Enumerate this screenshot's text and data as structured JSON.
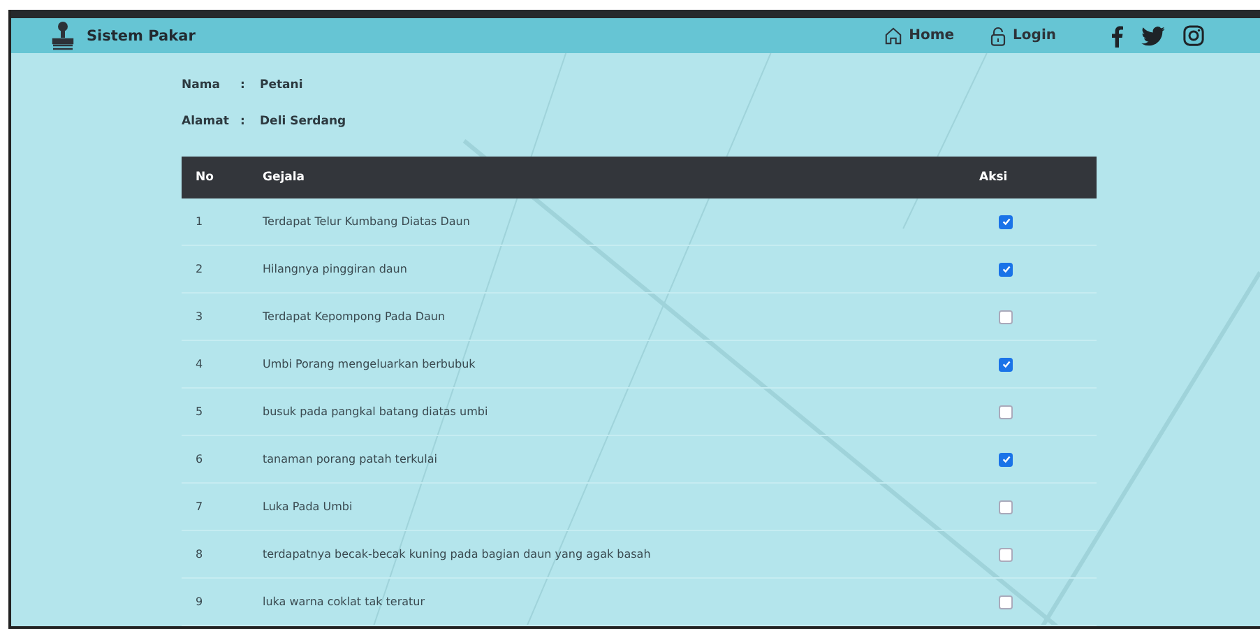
{
  "navbar": {
    "brand": "Sistem Pakar",
    "links": [
      {
        "kind": "home",
        "label": "Home"
      },
      {
        "kind": "login",
        "label": "Login"
      }
    ],
    "social": [
      {
        "kind": "facebook"
      },
      {
        "kind": "twitter"
      },
      {
        "kind": "instagram"
      }
    ]
  },
  "profile": [
    {
      "label": "Nama",
      "separator": ":",
      "value": "Petani"
    },
    {
      "label": "Alamat",
      "separator": ":",
      "value": "Deli Serdang"
    }
  ],
  "table": {
    "columns": [
      "No",
      "Gejala",
      "Aksi"
    ],
    "rows": [
      {
        "no": "1",
        "gejala": "Terdapat Telur Kumbang Diatas Daun",
        "checked": true
      },
      {
        "no": "2",
        "gejala": "Hilangnya pinggiran daun",
        "checked": true
      },
      {
        "no": "3",
        "gejala": "Terdapat Kepompong Pada Daun",
        "checked": false
      },
      {
        "no": "4",
        "gejala": "Umbi Porang mengeluarkan berbubuk",
        "checked": true
      },
      {
        "no": "5",
        "gejala": "busuk pada pangkal batang diatas umbi",
        "checked": false
      },
      {
        "no": "6",
        "gejala": "tanaman porang patah terkulai",
        "checked": true
      },
      {
        "no": "7",
        "gejala": "Luka Pada Umbi",
        "checked": false
      },
      {
        "no": "8",
        "gejala": "terdapatnya becak-becak kuning pada bagian daun yang agak basah",
        "checked": false
      },
      {
        "no": "9",
        "gejala": "luka warna coklat tak teratur",
        "checked": false
      }
    ]
  }
}
